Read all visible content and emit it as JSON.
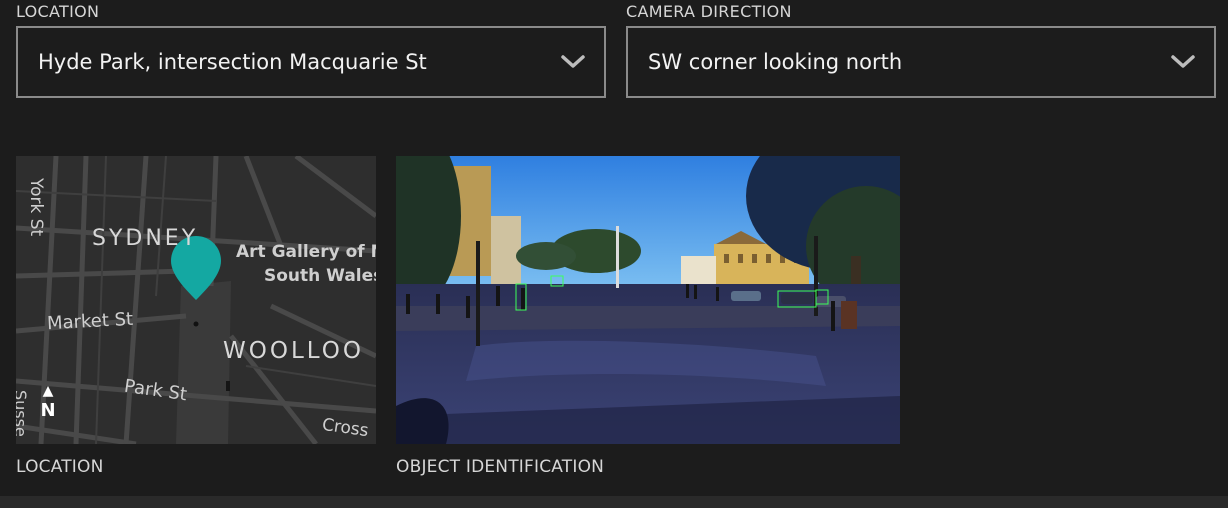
{
  "location_field": {
    "label": "LOCATION",
    "value": "Hyde Park, intersection Macquarie St",
    "icon": "chevron-down-icon"
  },
  "direction_field": {
    "label": "CAMERA DIRECTION",
    "value": "SW corner looking north",
    "icon": "chevron-down-icon"
  },
  "map": {
    "labels": {
      "york_st": "York St",
      "sydney": "SYDNEY",
      "art_gallery_1": "Art Gallery of N",
      "art_gallery_2": "South Wales",
      "market_st": "Market St",
      "woolloo": "WOOLLOO",
      "park_st": "Park St",
      "cross": "Cross",
      "sussex": "Susse"
    },
    "north_arrow": "▲",
    "north_label": "N",
    "pin_color": "#14a8a2",
    "caption": "LOCATION"
  },
  "camera": {
    "caption": "OBJECT IDENTIFICATION"
  },
  "colors": {
    "background": "#1c1c1c",
    "border": "#8a8a8a",
    "pin": "#14a8a2",
    "detection_box": "#3cff5a"
  }
}
